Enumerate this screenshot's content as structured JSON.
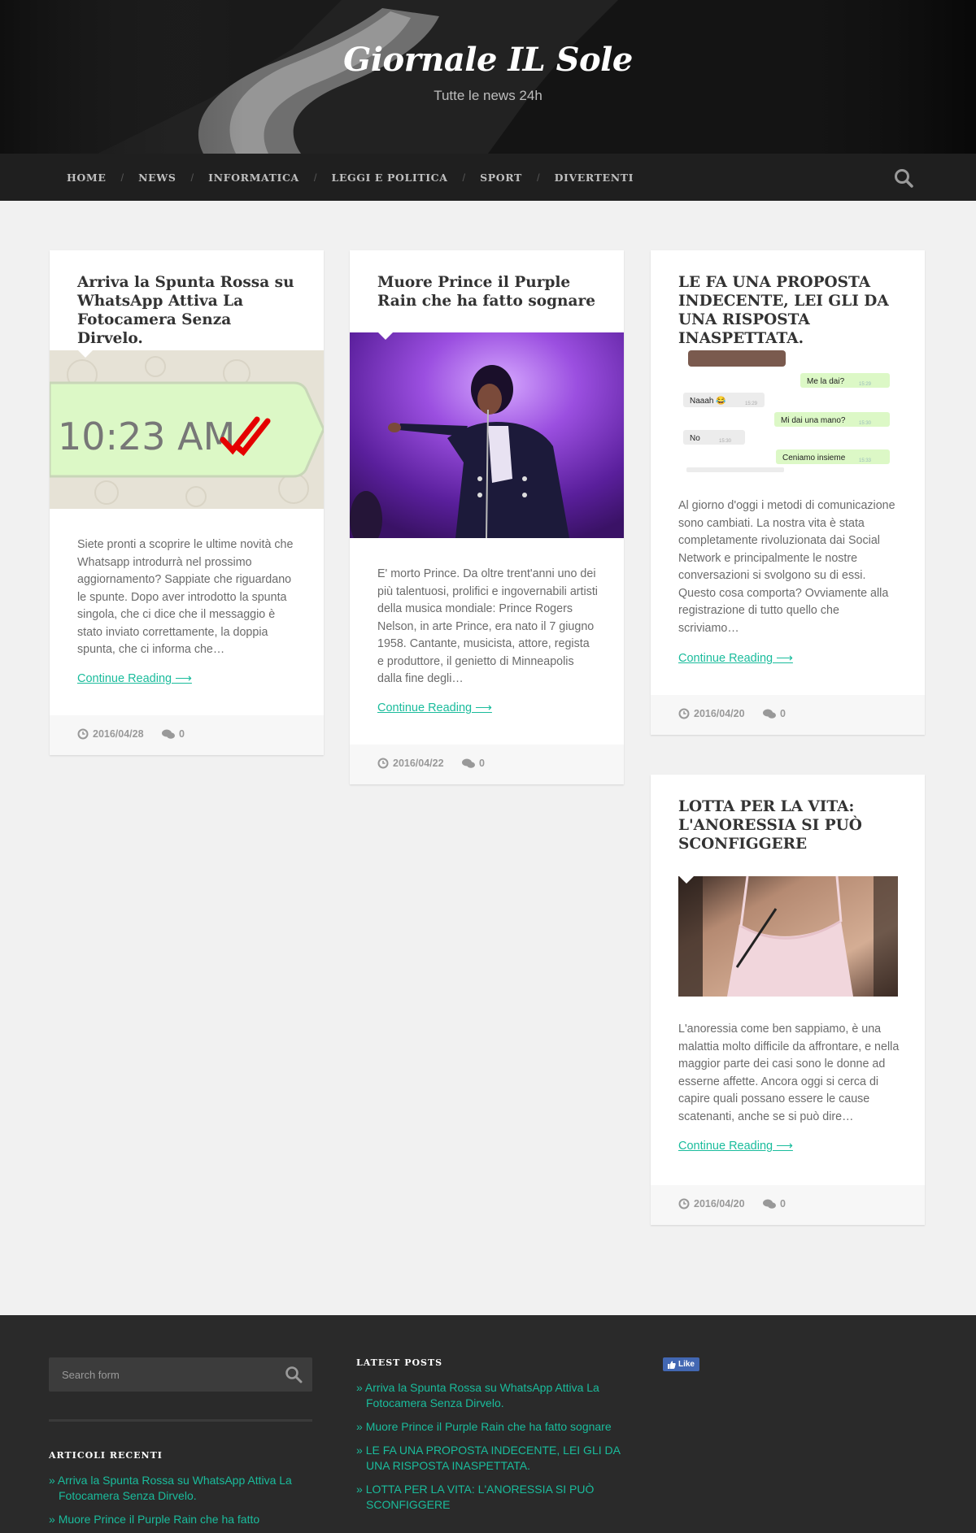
{
  "site": {
    "title": "Giornale IL Sole",
    "description": "Tutte le news 24h"
  },
  "nav": {
    "items": [
      "HOME",
      "NEWS",
      "INFORMATICA",
      "LEGGI E POLITICA",
      "SPORT",
      "DIVERTENTI"
    ],
    "separator": "/"
  },
  "posts": [
    {
      "title": "Arriva la Spunta Rossa su WhatsApp Attiva La Fotocamera Senza Dirvelo.",
      "image_text": "10:23 AM",
      "excerpt": "Siete pronti a scoprire le ultime novità che Whatsapp introdurrà nel prossimo aggiornamento? Sappiate che riguardano le spunte. Dopo aver introdotto la spunta singola, che ci dice che il messaggio è stato inviato correttamente, la doppia spunta, che ci informa che…",
      "more": "Continue Reading ⟶",
      "date": "2016/04/28",
      "comments": "0"
    },
    {
      "title": "Muore Prince il Purple Rain che ha fatto sognare",
      "excerpt": "E' morto Prince. Da oltre trent'anni uno dei più talentuosi, prolifici e ingovernabili artisti della musica mondiale: Prince Rogers Nelson, in arte Prince, era nato il 7 giugno 1958. Cantante, musicista, attore, regista e produttore, il genietto di Minneapolis dalla fine degli…",
      "more": "Continue Reading ⟶",
      "date": "2016/04/22",
      "comments": "0"
    },
    {
      "title": "LE FA UNA PROPOSTA INDECENTE, LEI GLI DA UNA RISPOSTA INASPETTATA.",
      "chat": [
        {
          "text": "Me la dai?",
          "time": "15:29",
          "side": "right"
        },
        {
          "text": "Naaah 😂",
          "time": "15:29",
          "side": "left"
        },
        {
          "text": "Mi dai una mano?",
          "time": "15:30",
          "side": "right"
        },
        {
          "text": "No",
          "time": "15:30",
          "side": "left"
        },
        {
          "text": "Ceniamo insieme",
          "time": "15:33",
          "side": "right"
        }
      ],
      "excerpt": "Al giorno d'oggi i metodi di comunicazione sono cambiati. La nostra vita è stata completamente rivoluzionata dai Social Network e principalmente le nostre conversazioni si svolgono su di essi. Questo cosa comporta? Ovviamente alla registrazione di tutto quello che scriviamo…",
      "more": "Continue Reading ⟶",
      "date": "2016/04/20",
      "comments": "0"
    },
    {
      "title": "LOTTA PER LA VITA: L'ANORESSIA SI PUÒ SCONFIGGERE",
      "excerpt": "L'anoressia come ben sappiamo, è una malattia molto difficile da affrontare, e nella maggior parte dei casi sono le donne ad esserne affette. Ancora oggi si cerca di capire quali possano essere le cause scatenanti, anche se si può dire…",
      "more": "Continue Reading ⟶",
      "date": "2016/04/20",
      "comments": "0"
    }
  ],
  "footer": {
    "search_placeholder": "Search form",
    "recent_title": "ARTICOLI RECENTI",
    "recent": [
      "Arriva la Spunta Rossa su WhatsApp Attiva La Fotocamera Senza Dirvelo.",
      "Muore Prince il Purple Rain che ha fatto"
    ],
    "latest_title": "LATEST POSTS",
    "latest": [
      "Arriva la Spunta Rossa su WhatsApp Attiva La Fotocamera Senza Dirvelo.",
      "Muore Prince il Purple Rain che ha fatto sognare",
      "LE FA UNA PROPOSTA INDECENTE, LEI GLI DA UNA RISPOSTA INASPETTATA.",
      "LOTTA PER LA VITA: L'ANORESSIA SI PUÒ SCONFIGGERE"
    ],
    "fb_like": "Like"
  },
  "colors": {
    "accent": "#1abc9c",
    "nav_bg": "#1f1f1f",
    "footer_bg": "#2a2a2a",
    "fb_blue": "#4267b2"
  },
  "icons": {
    "search": "search-icon",
    "date": "clock-icon",
    "comments": "comments-icon",
    "like": "thumbs-up-icon"
  }
}
